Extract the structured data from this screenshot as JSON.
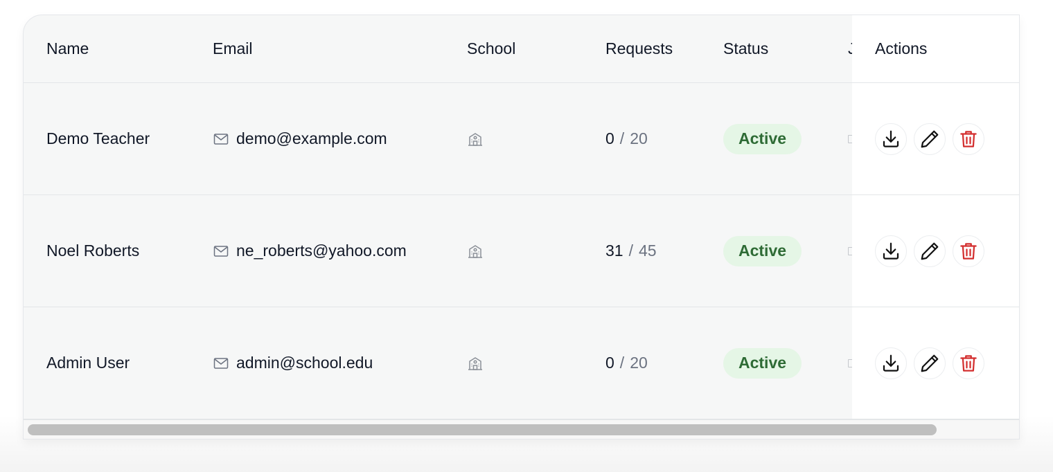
{
  "table": {
    "headers": {
      "name": "Name",
      "email": "Email",
      "school": "School",
      "requests": "Requests",
      "status": "Status",
      "joined_clipped": "J",
      "actions": "Actions"
    },
    "rows": [
      {
        "name": "Demo Teacher",
        "email": "demo@example.com",
        "requests_used": "0",
        "requests_sep": "/",
        "requests_total": "20",
        "status": "Active"
      },
      {
        "name": "Noel Roberts",
        "email": "ne_roberts@yahoo.com",
        "requests_used": "31",
        "requests_sep": "/",
        "requests_total": "45",
        "status": "Active"
      },
      {
        "name": "Admin User",
        "email": "admin@school.edu",
        "requests_used": "0",
        "requests_sep": "/",
        "requests_total": "20",
        "status": "Active"
      }
    ]
  },
  "icons": {
    "email": "mail-icon",
    "school": "school-building-icon",
    "joined": "calendar-icon",
    "download": "download-icon",
    "edit": "pencil-icon",
    "delete": "trash-icon"
  },
  "colors": {
    "status_bg": "#e5f6e6",
    "status_text": "#2e6b35",
    "delete": "#d32f2f",
    "muted": "#6b7280"
  }
}
